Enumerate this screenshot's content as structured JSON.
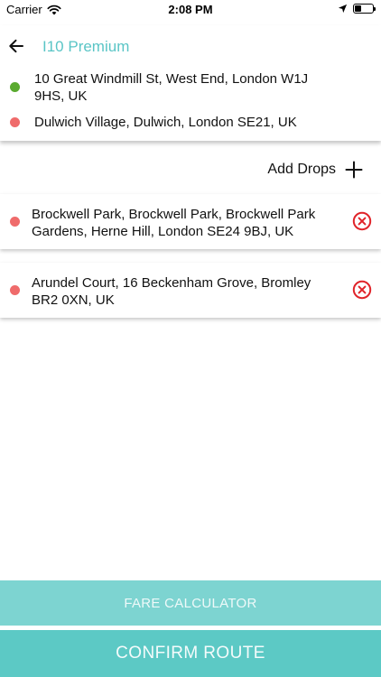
{
  "status_bar": {
    "carrier": "Carrier",
    "time": "2:08 PM",
    "battery_level": 0.35
  },
  "header": {
    "vehicle_title": "I10 Premium",
    "back_icon": "arrow-left-icon"
  },
  "route": {
    "pickup": {
      "address": "10 Great Windmill St, West End, London W1J 9HS, UK",
      "dot_color": "#5aaa2f"
    },
    "destination": {
      "address": "Dulwich Village, Dulwich, London SE21, UK",
      "dot_color": "#ef6b6b"
    }
  },
  "add_drops": {
    "label": "Add Drops",
    "icon": "plus-icon"
  },
  "drops": [
    {
      "address": "Brockwell Park, Brockwell Park, Brockwell Park Gardens, Herne Hill, London SE24 9BJ, UK",
      "dot_color": "#ef6b6b",
      "remove_icon": "remove-circle-x-icon"
    },
    {
      "address": "Arundel Court, 16 Beckenham Grove, Bromley BR2 0XN, UK",
      "dot_color": "#ef6b6b",
      "remove_icon": "remove-circle-x-icon"
    }
  ],
  "buttons": {
    "fare_calculator": "FARE CALCULATOR",
    "confirm_route": "CONFIRM ROUTE"
  },
  "colors": {
    "accent": "#5ac5c6",
    "fare_button": "#7dd4d1",
    "confirm_button": "#5cc9c5",
    "remove": "#e0242a"
  }
}
